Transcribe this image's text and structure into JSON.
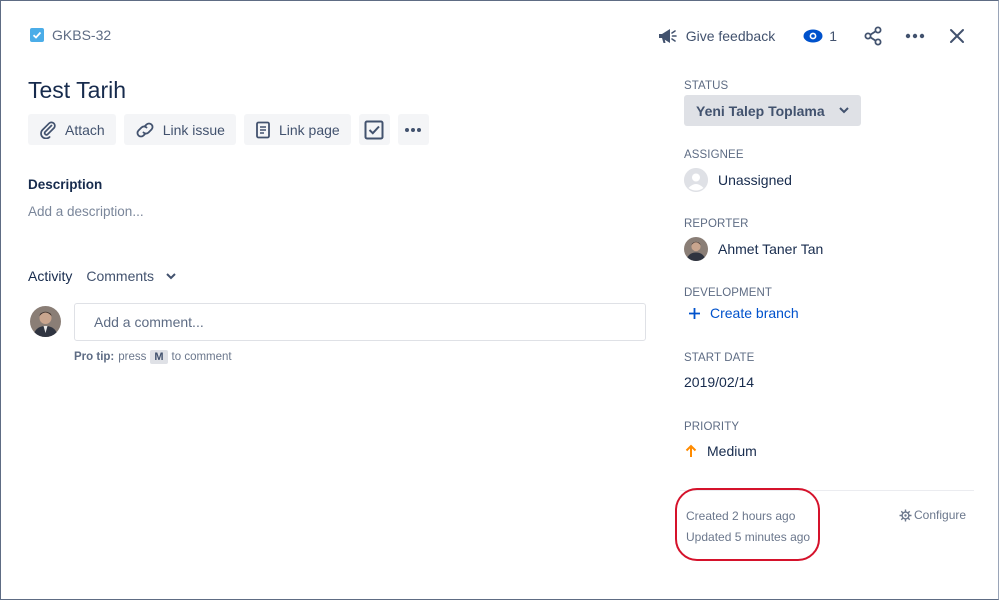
{
  "issue": {
    "key": "GKBS-32",
    "title": "Test Tarih"
  },
  "topbar": {
    "feedback_label": "Give feedback",
    "watch_count": "1"
  },
  "actions": {
    "attach": "Attach",
    "link_issue": "Link issue",
    "link_page": "Link page"
  },
  "description": {
    "label": "Description",
    "placeholder": "Add a description..."
  },
  "activity": {
    "label": "Activity",
    "filter": "Comments",
    "comment_placeholder": "Add a comment...",
    "protip_prefix": "Pro tip:",
    "protip_press": "press",
    "protip_key": "M",
    "protip_suffix": "to comment"
  },
  "sidebar": {
    "status_label": "STATUS",
    "status_value": "Yeni Talep Toplama",
    "assignee_label": "ASSIGNEE",
    "assignee_value": "Unassigned",
    "reporter_label": "REPORTER",
    "reporter_value": "Ahmet Taner Tan",
    "development_label": "DEVELOPMENT",
    "development_action": "Create branch",
    "start_date_label": "START DATE",
    "start_date_value": "2019/02/14",
    "priority_label": "PRIORITY",
    "priority_value": "Medium",
    "created": "Created 2 hours ago",
    "updated": "Updated 5 minutes ago",
    "configure": "Configure"
  },
  "colors": {
    "link": "#0052cc",
    "priority_medium": "#ff8b00",
    "highlight": "#d5122b",
    "issue_type": "#4bade8"
  }
}
